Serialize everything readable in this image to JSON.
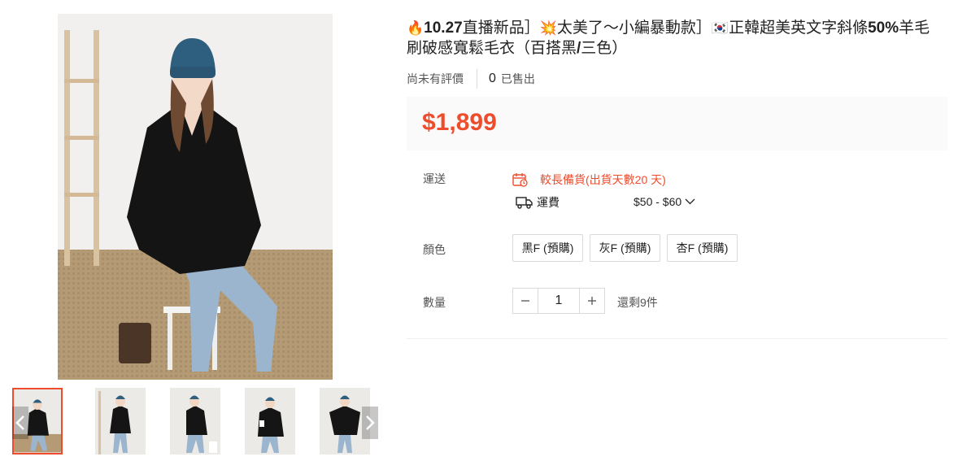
{
  "product": {
    "title_parts": [
      {
        "text": "🔥",
        "style": "emo"
      },
      {
        "text": "10.27",
        "style": "em"
      },
      {
        "text": "直播新品］",
        "style": ""
      },
      {
        "text": "💥",
        "style": "emo"
      },
      {
        "text": "太美了～小編暴動款］",
        "style": ""
      },
      {
        "text": "🇰🇷",
        "style": "emo"
      },
      {
        "text": "正韓超美英文字斜條",
        "style": ""
      },
      {
        "text": "50%",
        "style": "em"
      },
      {
        "text": "羊毛刷破感寬鬆毛衣（百搭黑",
        "style": ""
      },
      {
        "text": "/",
        "style": "em"
      },
      {
        "text": "三色）",
        "style": ""
      }
    ],
    "rating_text": "尚未有評價",
    "sold_count": "0",
    "sold_label": "已售出",
    "price": "$1,899"
  },
  "shipping": {
    "label": "運送",
    "status": "較長備貨(出貨天數20 天)",
    "fee_label": "運費",
    "fee_value": "$50 - $60",
    "icons": {
      "status": "calendar-clock-icon",
      "fee": "truck-icon",
      "dropdown": "chevron-down-icon"
    }
  },
  "color": {
    "label": "顏色",
    "options": [
      "黑F (預購)",
      "灰F (預購)",
      "杏F (預購)"
    ]
  },
  "quantity": {
    "label": "數量",
    "value": "1",
    "stock": "還剩9件"
  },
  "gallery": {
    "thumbnail_count": 5,
    "active_index": 0
  },
  "colors": {
    "accent": "#ee4d2d",
    "price_bg": "#fafafa",
    "border": "#d9d9d9"
  }
}
